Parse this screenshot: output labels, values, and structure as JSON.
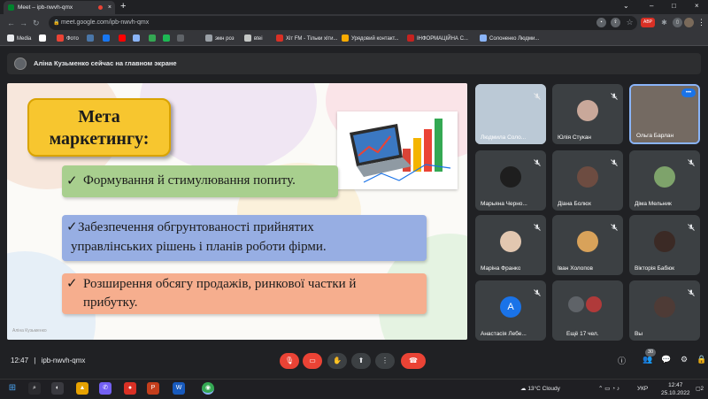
{
  "browser": {
    "tab_title": "Meet – ipb-nwvh-qmx",
    "url": "meet.google.com/ipb-nwvh-qmx",
    "new_tab": "+",
    "tab_close": "×",
    "back": "←",
    "forward": "→",
    "reload": "↻",
    "menu": "⋮",
    "extension_label": "ABP",
    "bookmarks": [
      {
        "label": "Media",
        "color": "#e8eaed"
      },
      {
        "label": "",
        "color": "#ffffff"
      },
      {
        "label": "Фото",
        "color": "#ea4335"
      },
      {
        "label": "",
        "color": "#4a76a8"
      },
      {
        "label": "",
        "color": "#1877f2"
      },
      {
        "label": "",
        "color": "#ff0000"
      },
      {
        "label": "",
        "color": "#8ab4f8"
      },
      {
        "label": "",
        "color": "#34a853"
      },
      {
        "label": "",
        "color": "#1db954"
      },
      {
        "label": "",
        "color": "#5f6368"
      },
      {
        "label": "эмн роз",
        "color": "#9aa0a6"
      },
      {
        "label": "вtei",
        "color": "#c4c7c5"
      },
      {
        "label": "Хіт FM - Тільки хіти...",
        "color": "#d93025"
      },
      {
        "label": "Урядовий контакт...",
        "color": "#f9ab00"
      },
      {
        "label": "ІНФОРМАЦІЙНА С...",
        "color": "#c5221f"
      },
      {
        "label": "Солоненко Людми...",
        "color": "#8ab4f8"
      }
    ]
  },
  "meet": {
    "presenting_banner": "Аліна Кузьменко сейчас на главном экране",
    "meeting_time": "12:47",
    "separator": "|",
    "meeting_code": "ipb-nwvh-qmx",
    "participant_count": "30",
    "controls": [
      {
        "name": "mic-off",
        "glyph": "🎙"
      },
      {
        "name": "camera-off",
        "glyph": "▭"
      },
      {
        "name": "raise-hand",
        "glyph": "✋"
      },
      {
        "name": "present",
        "glyph": "⬆"
      },
      {
        "name": "more-options",
        "glyph": "⋮"
      },
      {
        "name": "leave-call",
        "glyph": "☎"
      }
    ],
    "right_controls": [
      {
        "name": "info",
        "glyph": "ⓘ"
      },
      {
        "name": "people",
        "glyph": "👥"
      },
      {
        "name": "chat",
        "glyph": "💬"
      },
      {
        "name": "activities",
        "glyph": "⚙"
      },
      {
        "name": "shield",
        "glyph": "🔒"
      }
    ]
  },
  "slide": {
    "heading_line1": "Мета",
    "heading_line2": "маркетингу:",
    "item1": "Формування й стимулювання попиту.",
    "item2_line1": "Забезпечення обгрунтованості прийнятих",
    "item2_line2": "управлінських рішень і планів роботи фірми.",
    "item3_line1": "Розширення обсягу продажів, ринкової частки й",
    "item3_line2": "прибутку.",
    "check": "✓",
    "footer": "Аліна Кузьменко"
  },
  "participants": [
    {
      "name": "Людмила Соло...",
      "muted": true,
      "avatar_color": "#b8c7d4"
    },
    {
      "name": "Юлія Стукан",
      "muted": true,
      "avatar_color": "#c9a89a"
    },
    {
      "name": "Ольга Барлан",
      "muted": false,
      "avatar_color": "#7a6f66",
      "more": "•••"
    },
    {
      "name": "Марьяна Черно...",
      "muted": true,
      "avatar_color": "#1e1e1e"
    },
    {
      "name": "Діана Болюх",
      "muted": true,
      "avatar_color": "#6d4c41"
    },
    {
      "name": "Діма Мельник",
      "muted": true,
      "avatar_color": "#7ea36b"
    },
    {
      "name": "Маріна Франко",
      "muted": true,
      "avatar_color": "#e2c7b0"
    },
    {
      "name": "Іван Холопов",
      "muted": true,
      "avatar_color": "#d8a25a"
    },
    {
      "name": "Вікторія Бабюк",
      "muted": true,
      "avatar_color": "#3b2a25"
    },
    {
      "name": "Анастасія Лебе...",
      "muted": true,
      "avatar_color": "#1a73e8",
      "initial": "А"
    },
    {
      "name": "Ещё 17 чел.",
      "muted": false,
      "avatar_color": "#5f6368"
    },
    {
      "name": "Вы",
      "muted": true,
      "avatar_color": "#4e3b36"
    }
  ],
  "taskbar": {
    "weather": "13°C  Cloudy",
    "language": "УКР",
    "clock_time": "12:47",
    "clock_date": "25.10.2022",
    "notification_count": "2",
    "apps": [
      {
        "name": "search",
        "glyph": "⌕",
        "color": "#2b2b2f"
      },
      {
        "name": "tasks",
        "glyph": "◐",
        "color": "#3a3a40"
      },
      {
        "name": "app-triangle",
        "glyph": "▲",
        "color": "#e6a100"
      },
      {
        "name": "viber",
        "glyph": "✆",
        "color": "#7360f2"
      },
      {
        "name": "app-red-circle",
        "glyph": "●",
        "color": "#d93025"
      },
      {
        "name": "powerpoint",
        "glyph": "P",
        "color": "#c43e1c"
      },
      {
        "name": "word",
        "glyph": "W",
        "color": "#185abd"
      },
      {
        "name": "chrome",
        "glyph": "◉",
        "color": "#34a853"
      }
    ]
  }
}
